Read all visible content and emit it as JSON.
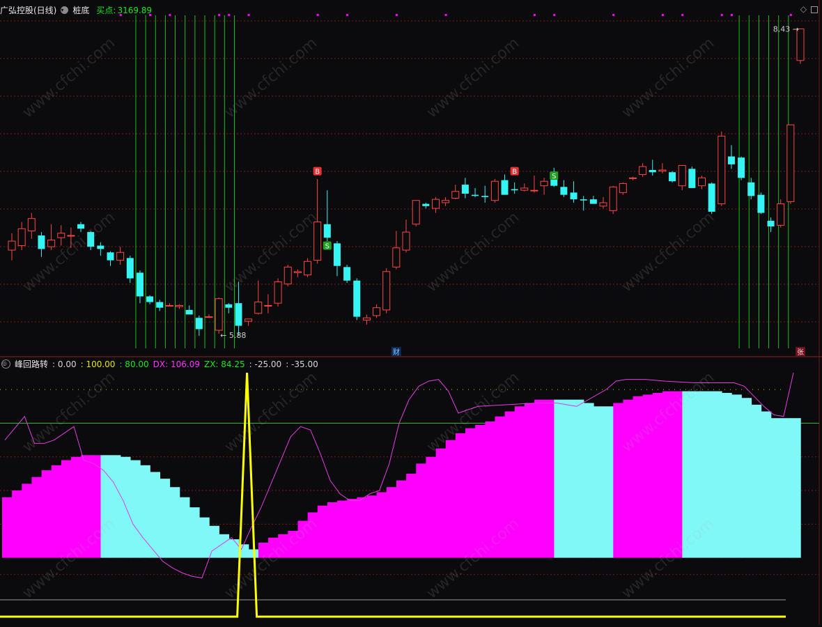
{
  "main_header": {
    "stock": "广弘控股(日线)",
    "indicator": "桩底",
    "buy_label": "买点:",
    "buy_value": "3169.89"
  },
  "indicator_header": {
    "name": "峰回路转",
    "values": [
      {
        "label": "",
        "value": ": 0.00",
        "color": "#d8d8d8"
      },
      {
        "label": "",
        "value": ": 100.00",
        "color": "#e6e600"
      },
      {
        "label": "",
        "value": ": 80.00",
        "color": "#19e619"
      },
      {
        "label": "DX:",
        "value": "106.09",
        "color": "#ff30ff"
      },
      {
        "label": "ZX:",
        "value": "84.25",
        "color": "#19e619"
      },
      {
        "label": "",
        "value": ": -25.00",
        "color": "#d8d8d8"
      },
      {
        "label": "",
        "value": ": -35.00",
        "color": "#d8d8d8"
      }
    ]
  },
  "watermark": "www.cfchi.com",
  "colors": {
    "up": "#ff4444",
    "down": "#34f4f4",
    "grid": "#7a1818",
    "magenta": "#ff00ff",
    "cyan": "#80f8f8",
    "yellow": "#ffff00",
    "green": "#19c019"
  },
  "chart_data": [
    {
      "type": "candlestick",
      "y_range": [
        5.6,
        8.55
      ],
      "candles": [
        {
          "o": 6.47,
          "h": 6.62,
          "l": 6.38,
          "c": 6.55
        },
        {
          "o": 6.51,
          "h": 6.72,
          "l": 6.47,
          "c": 6.66
        },
        {
          "o": 6.64,
          "h": 6.8,
          "l": 6.57,
          "c": 6.75
        },
        {
          "o": 6.6,
          "h": 6.63,
          "l": 6.41,
          "c": 6.48
        },
        {
          "o": 6.5,
          "h": 6.7,
          "l": 6.47,
          "c": 6.56
        },
        {
          "o": 6.58,
          "h": 6.69,
          "l": 6.51,
          "c": 6.62
        },
        {
          "o": 6.6,
          "h": 6.67,
          "l": 6.49,
          "c": 6.6
        },
        {
          "o": 6.7,
          "h": 6.72,
          "l": 6.63,
          "c": 6.66
        },
        {
          "o": 6.63,
          "h": 6.64,
          "l": 6.47,
          "c": 6.5
        },
        {
          "o": 6.51,
          "h": 6.54,
          "l": 6.42,
          "c": 6.48
        },
        {
          "o": 6.45,
          "h": 6.46,
          "l": 6.33,
          "c": 6.38
        },
        {
          "o": 6.38,
          "h": 6.5,
          "l": 6.34,
          "c": 6.45
        },
        {
          "o": 6.4,
          "h": 6.42,
          "l": 6.18,
          "c": 6.22
        },
        {
          "o": 6.27,
          "h": 6.29,
          "l": 6.0,
          "c": 6.06
        },
        {
          "o": 6.06,
          "h": 6.07,
          "l": 5.99,
          "c": 6.01
        },
        {
          "o": 6.01,
          "h": 6.03,
          "l": 5.93,
          "c": 5.96
        },
        {
          "o": 5.98,
          "h": 6.0,
          "l": 5.97,
          "c": 5.98
        },
        {
          "o": 5.97,
          "h": 5.99,
          "l": 5.95,
          "c": 5.98
        },
        {
          "o": 5.94,
          "h": 5.98,
          "l": 5.91,
          "c": 5.9
        },
        {
          "o": 5.87,
          "h": 5.89,
          "l": 5.71,
          "c": 5.77
        },
        {
          "o": 5.88,
          "h": 5.9,
          "l": 5.87,
          "c": 5.88
        },
        {
          "o": 5.76,
          "h": 6.05,
          "l": 5.73,
          "c": 6.04
        },
        {
          "o": 5.99,
          "h": 6.0,
          "l": 5.91,
          "c": 5.96
        },
        {
          "o": 6.0,
          "h": 6.19,
          "l": 5.71,
          "c": 5.8
        },
        {
          "o": 5.84,
          "h": 5.86,
          "l": 5.8,
          "c": 5.86
        },
        {
          "o": 5.91,
          "h": 6.2,
          "l": 5.9,
          "c": 6.01
        },
        {
          "o": 5.98,
          "h": 6.08,
          "l": 5.91,
          "c": 5.98
        },
        {
          "o": 6.0,
          "h": 6.22,
          "l": 5.97,
          "c": 6.19
        },
        {
          "o": 6.17,
          "h": 6.34,
          "l": 6.15,
          "c": 6.32
        },
        {
          "o": 6.27,
          "h": 6.3,
          "l": 6.23,
          "c": 6.28
        },
        {
          "o": 6.25,
          "h": 6.4,
          "l": 6.23,
          "c": 6.37
        },
        {
          "o": 6.38,
          "h": 7.1,
          "l": 6.35,
          "c": 6.72
        },
        {
          "o": 6.7,
          "h": 7.0,
          "l": 6.55,
          "c": 6.58
        },
        {
          "o": 6.53,
          "h": 6.55,
          "l": 6.24,
          "c": 6.33
        },
        {
          "o": 6.32,
          "h": 6.34,
          "l": 6.18,
          "c": 6.2
        },
        {
          "o": 6.2,
          "h": 6.22,
          "l": 5.85,
          "c": 5.88
        },
        {
          "o": 5.85,
          "h": 5.9,
          "l": 5.81,
          "c": 5.87
        },
        {
          "o": 5.89,
          "h": 5.99,
          "l": 5.87,
          "c": 5.96
        },
        {
          "o": 5.94,
          "h": 6.31,
          "l": 5.91,
          "c": 6.28
        },
        {
          "o": 6.32,
          "h": 6.64,
          "l": 6.3,
          "c": 6.49
        },
        {
          "o": 6.47,
          "h": 6.74,
          "l": 6.45,
          "c": 6.63
        },
        {
          "o": 6.7,
          "h": 6.91,
          "l": 6.68,
          "c": 6.91
        },
        {
          "o": 6.88,
          "h": 6.89,
          "l": 6.84,
          "c": 6.86
        },
        {
          "o": 6.84,
          "h": 6.94,
          "l": 6.8,
          "c": 6.92
        },
        {
          "o": 6.89,
          "h": 6.94,
          "l": 6.86,
          "c": 6.91
        },
        {
          "o": 6.93,
          "h": 7.05,
          "l": 6.92,
          "c": 6.99
        },
        {
          "o": 7.05,
          "h": 7.11,
          "l": 6.93,
          "c": 6.97
        },
        {
          "o": 6.96,
          "h": 7.02,
          "l": 6.94,
          "c": 6.95
        },
        {
          "o": 6.95,
          "h": 7.04,
          "l": 6.89,
          "c": 6.94
        },
        {
          "o": 6.91,
          "h": 7.1,
          "l": 6.89,
          "c": 7.08
        },
        {
          "o": 7.09,
          "h": 7.14,
          "l": 6.96,
          "c": 6.96
        },
        {
          "o": 7.01,
          "h": 7.07,
          "l": 6.97,
          "c": 7.0
        },
        {
          "o": 7.0,
          "h": 7.06,
          "l": 6.99,
          "c": 7.02
        },
        {
          "o": 7.0,
          "h": 7.13,
          "l": 6.98,
          "c": 7.0
        },
        {
          "o": 7.04,
          "h": 7.11,
          "l": 6.96,
          "c": 7.08
        },
        {
          "o": 7.14,
          "h": 7.2,
          "l": 7.03,
          "c": 7.04
        },
        {
          "o": 7.03,
          "h": 7.09,
          "l": 6.94,
          "c": 6.96
        },
        {
          "o": 6.98,
          "h": 7.08,
          "l": 6.89,
          "c": 6.92
        },
        {
          "o": 6.92,
          "h": 6.95,
          "l": 6.82,
          "c": 6.91
        },
        {
          "o": 6.92,
          "h": 6.95,
          "l": 6.88,
          "c": 6.88
        },
        {
          "o": 6.86,
          "h": 6.94,
          "l": 6.84,
          "c": 6.89
        },
        {
          "o": 6.82,
          "h": 7.04,
          "l": 6.79,
          "c": 7.03
        },
        {
          "o": 6.98,
          "h": 7.07,
          "l": 6.96,
          "c": 7.06
        },
        {
          "o": 7.11,
          "h": 7.12,
          "l": 7.09,
          "c": 7.11
        },
        {
          "o": 7.14,
          "h": 7.24,
          "l": 7.12,
          "c": 7.21
        },
        {
          "o": 7.18,
          "h": 7.27,
          "l": 7.13,
          "c": 7.16
        },
        {
          "o": 7.17,
          "h": 7.24,
          "l": 7.15,
          "c": 7.18
        },
        {
          "o": 7.16,
          "h": 7.17,
          "l": 7.07,
          "c": 7.08
        },
        {
          "o": 7.04,
          "h": 7.21,
          "l": 7.0,
          "c": 7.22
        },
        {
          "o": 7.19,
          "h": 7.21,
          "l": 7.02,
          "c": 7.02
        },
        {
          "o": 7.04,
          "h": 7.13,
          "l": 7.01,
          "c": 7.11
        },
        {
          "o": 7.06,
          "h": 7.07,
          "l": 6.79,
          "c": 6.81
        },
        {
          "o": 6.88,
          "h": 7.52,
          "l": 6.86,
          "c": 7.48
        },
        {
          "o": 7.3,
          "h": 7.4,
          "l": 7.19,
          "c": 7.23
        },
        {
          "o": 7.29,
          "h": 7.3,
          "l": 7.09,
          "c": 7.11
        },
        {
          "o": 7.07,
          "h": 7.11,
          "l": 6.92,
          "c": 6.95
        },
        {
          "o": 6.96,
          "h": 6.98,
          "l": 6.79,
          "c": 6.8
        },
        {
          "o": 6.73,
          "h": 6.76,
          "l": 6.63,
          "c": 6.68
        },
        {
          "o": 6.69,
          "h": 6.92,
          "l": 6.67,
          "c": 6.88
        },
        {
          "o": 6.9,
          "h": 7.57,
          "l": 6.88,
          "c": 7.58
        },
        {
          "o": 8.15,
          "h": 8.43,
          "l": 8.12,
          "c": 8.43
        }
      ],
      "annotations": [
        {
          "text": "B",
          "index": 31,
          "y": 7.17,
          "color": "#e83030"
        },
        {
          "text": "S",
          "index": 32,
          "y": 6.51,
          "color": "#20a020"
        },
        {
          "text": "B",
          "index": 51,
          "y": 7.17,
          "color": "#e83030"
        },
        {
          "text": "S",
          "index": 55,
          "y": 7.13,
          "color": "#20a020"
        },
        {
          "text": "← 5.88",
          "index": 21,
          "y": 5.71,
          "color": "#cccccc"
        },
        {
          "text": "8.43 →",
          "index": 80,
          "y": 8.43,
          "color": "#cccccc"
        }
      ],
      "markers": [
        {
          "text": "财",
          "index": 39
        },
        {
          "text": "张",
          "index": 80
        }
      ]
    },
    {
      "type": "bar",
      "y_range": [
        -37,
        110
      ],
      "levels": [
        100,
        80,
        0,
        -25,
        -35
      ],
      "hist": [
        {
          "v": 36,
          "c": "m"
        },
        {
          "v": 40,
          "c": "m"
        },
        {
          "v": 44,
          "c": "m"
        },
        {
          "v": 48,
          "c": "m"
        },
        {
          "v": 52,
          "c": "m"
        },
        {
          "v": 55,
          "c": "m"
        },
        {
          "v": 58,
          "c": "m"
        },
        {
          "v": 60,
          "c": "m"
        },
        {
          "v": 61,
          "c": "m"
        },
        {
          "v": 61,
          "c": "m"
        },
        {
          "v": 61,
          "c": "c"
        },
        {
          "v": 61,
          "c": "c"
        },
        {
          "v": 60,
          "c": "c"
        },
        {
          "v": 58,
          "c": "c"
        },
        {
          "v": 55,
          "c": "c"
        },
        {
          "v": 51,
          "c": "c"
        },
        {
          "v": 47,
          "c": "c"
        },
        {
          "v": 42,
          "c": "c"
        },
        {
          "v": 36,
          "c": "c"
        },
        {
          "v": 30,
          "c": "c"
        },
        {
          "v": 24,
          "c": "c"
        },
        {
          "v": 19,
          "c": "c"
        },
        {
          "v": 14,
          "c": "c"
        },
        {
          "v": 11,
          "c": "c"
        },
        {
          "v": 8,
          "c": "c"
        },
        {
          "v": 5,
          "c": "c"
        },
        {
          "v": 9,
          "c": "m"
        },
        {
          "v": 12,
          "c": "m"
        },
        {
          "v": 14,
          "c": "m"
        },
        {
          "v": 16,
          "c": "m"
        },
        {
          "v": 22,
          "c": "m"
        },
        {
          "v": 27,
          "c": "m"
        },
        {
          "v": 31,
          "c": "m"
        },
        {
          "v": 33,
          "c": "m"
        },
        {
          "v": 34,
          "c": "m"
        },
        {
          "v": 35,
          "c": "m"
        },
        {
          "v": 36,
          "c": "m"
        },
        {
          "v": 37,
          "c": "m"
        },
        {
          "v": 39,
          "c": "m"
        },
        {
          "v": 42,
          "c": "m"
        },
        {
          "v": 46,
          "c": "m"
        },
        {
          "v": 50,
          "c": "m"
        },
        {
          "v": 56,
          "c": "m"
        },
        {
          "v": 60,
          "c": "m"
        },
        {
          "v": 65,
          "c": "m"
        },
        {
          "v": 70,
          "c": "m"
        },
        {
          "v": 74,
          "c": "m"
        },
        {
          "v": 77,
          "c": "m"
        },
        {
          "v": 79,
          "c": "m"
        },
        {
          "v": 81,
          "c": "m"
        },
        {
          "v": 84,
          "c": "m"
        },
        {
          "v": 87,
          "c": "m"
        },
        {
          "v": 90,
          "c": "m"
        },
        {
          "v": 92,
          "c": "m"
        },
        {
          "v": 94,
          "c": "m"
        },
        {
          "v": 94,
          "c": "m"
        },
        {
          "v": 94,
          "c": "c"
        },
        {
          "v": 94,
          "c": "c"
        },
        {
          "v": 94,
          "c": "c"
        },
        {
          "v": 92,
          "c": "c"
        },
        {
          "v": 90,
          "c": "c"
        },
        {
          "v": 90,
          "c": "c"
        },
        {
          "v": 92,
          "c": "m"
        },
        {
          "v": 94,
          "c": "m"
        },
        {
          "v": 96,
          "c": "m"
        },
        {
          "v": 97,
          "c": "m"
        },
        {
          "v": 98,
          "c": "m"
        },
        {
          "v": 99,
          "c": "m"
        },
        {
          "v": 99,
          "c": "m"
        },
        {
          "v": 99,
          "c": "c"
        },
        {
          "v": 99,
          "c": "c"
        },
        {
          "v": 99,
          "c": "c"
        },
        {
          "v": 99,
          "c": "c"
        },
        {
          "v": 98,
          "c": "c"
        },
        {
          "v": 97,
          "c": "c"
        },
        {
          "v": 95,
          "c": "c"
        },
        {
          "v": 91,
          "c": "c"
        },
        {
          "v": 87,
          "c": "c"
        },
        {
          "v": 83,
          "c": "c"
        },
        {
          "v": 83,
          "c": "c"
        },
        {
          "v": 83,
          "c": "c"
        }
      ],
      "line": [
        {
          "i": 0,
          "v": 70
        },
        {
          "i": 2,
          "v": 84
        },
        {
          "i": 3,
          "v": 68
        },
        {
          "i": 4,
          "v": 68
        },
        {
          "i": 5,
          "v": 70
        },
        {
          "i": 6,
          "v": 74
        },
        {
          "i": 7,
          "v": 78
        },
        {
          "i": 8,
          "v": 58
        },
        {
          "i": 9,
          "v": 56
        },
        {
          "i": 10,
          "v": 52
        },
        {
          "i": 11,
          "v": 45
        },
        {
          "i": 12,
          "v": 34
        },
        {
          "i": 13,
          "v": 20
        },
        {
          "i": 14,
          "v": 12
        },
        {
          "i": 15,
          "v": 5
        },
        {
          "i": 16,
          "v": -2
        },
        {
          "i": 17,
          "v": -6
        },
        {
          "i": 18,
          "v": -9
        },
        {
          "i": 19,
          "v": -11
        },
        {
          "i": 20,
          "v": -12
        },
        {
          "i": 21,
          "v": 4
        },
        {
          "i": 22,
          "v": 8
        },
        {
          "i": 23,
          "v": 12
        },
        {
          "i": 24,
          "v": 5
        },
        {
          "i": 25,
          "v": 18
        },
        {
          "i": 26,
          "v": 30
        },
        {
          "i": 27,
          "v": 44
        },
        {
          "i": 28,
          "v": 58
        },
        {
          "i": 29,
          "v": 72
        },
        {
          "i": 30,
          "v": 78
        },
        {
          "i": 31,
          "v": 76
        },
        {
          "i": 32,
          "v": 62
        },
        {
          "i": 33,
          "v": 46
        },
        {
          "i": 34,
          "v": 38
        },
        {
          "i": 35,
          "v": 34
        },
        {
          "i": 36,
          "v": 34
        },
        {
          "i": 37,
          "v": 38
        },
        {
          "i": 38,
          "v": 40
        },
        {
          "i": 39,
          "v": 56
        },
        {
          "i": 40,
          "v": 80
        },
        {
          "i": 41,
          "v": 94
        },
        {
          "i": 42,
          "v": 102
        },
        {
          "i": 43,
          "v": 105
        },
        {
          "i": 44,
          "v": 106
        },
        {
          "i": 45,
          "v": 99
        },
        {
          "i": 46,
          "v": 86
        },
        {
          "i": 47,
          "v": 88
        },
        {
          "i": 48,
          "v": 90
        },
        {
          "i": 54,
          "v": 92
        },
        {
          "i": 56,
          "v": 92
        },
        {
          "i": 58,
          "v": 90
        },
        {
          "i": 61,
          "v": 100
        },
        {
          "i": 62,
          "v": 105
        },
        {
          "i": 63,
          "v": 106
        },
        {
          "i": 65,
          "v": 106
        },
        {
          "i": 67,
          "v": 105
        },
        {
          "i": 70,
          "v": 104
        },
        {
          "i": 72,
          "v": 104
        },
        {
          "i": 74,
          "v": 104
        },
        {
          "i": 75,
          "v": 102
        },
        {
          "i": 76,
          "v": 96
        },
        {
          "i": 77,
          "v": 90
        },
        {
          "i": 78,
          "v": 85
        },
        {
          "i": 79,
          "v": 84
        },
        {
          "i": 80,
          "v": 110
        }
      ],
      "spike": {
        "index": 24,
        "value": 110,
        "base": -35
      }
    }
  ]
}
